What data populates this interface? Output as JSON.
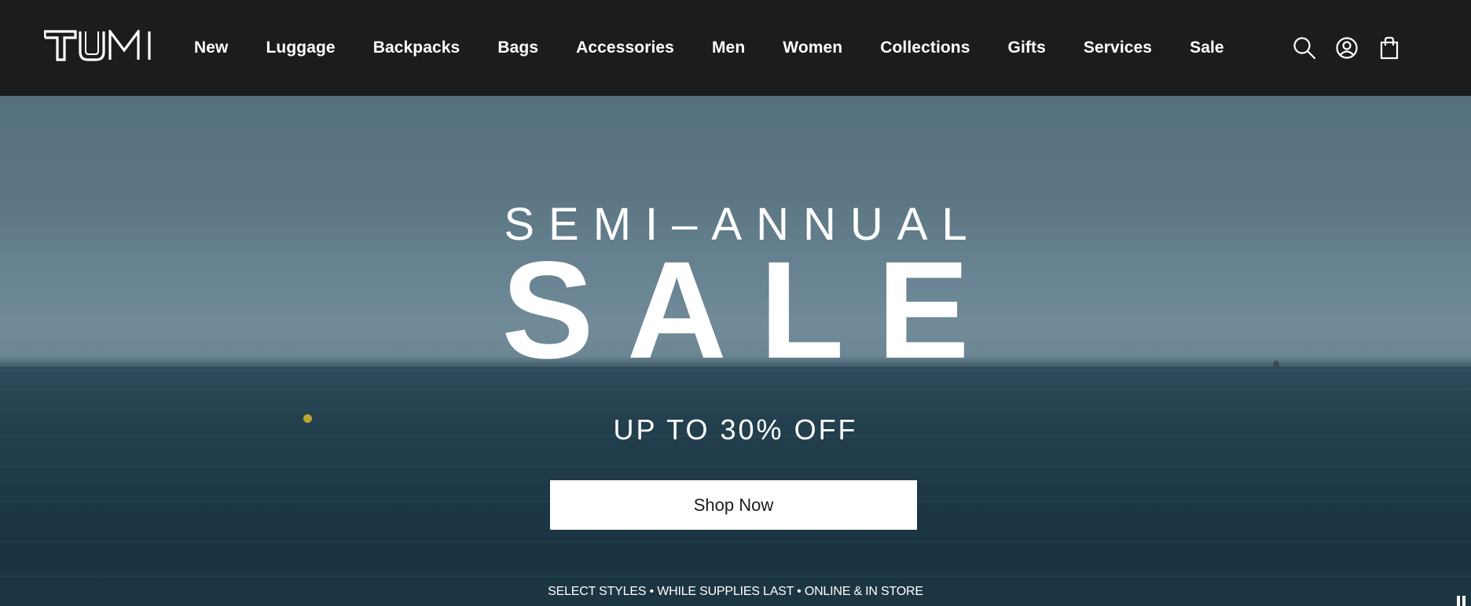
{
  "brand": {
    "logo_text": "TUMI"
  },
  "nav": {
    "items": [
      {
        "label": "New"
      },
      {
        "label": "Luggage"
      },
      {
        "label": "Backpacks"
      },
      {
        "label": "Bags"
      },
      {
        "label": "Accessories"
      },
      {
        "label": "Men"
      },
      {
        "label": "Women"
      },
      {
        "label": "Collections"
      },
      {
        "label": "Gifts"
      },
      {
        "label": "Services"
      },
      {
        "label": "Sale"
      }
    ]
  },
  "header_icons": [
    "search-icon",
    "account-icon",
    "shopping-bag-icon"
  ],
  "hero": {
    "subtitle": "SEMI–ANNUAL",
    "title": "SALE",
    "offer": "UP TO 30% OFF",
    "cta_label": "Shop Now",
    "fine_print": "SELECT STYLES • WHILE SUPPLIES LAST • ONLINE & IN STORE"
  },
  "colors": {
    "header_bg": "#1b1c1e",
    "text_primary": "#ffffff",
    "button_bg": "#ffffff",
    "button_text": "#1b1c1e"
  }
}
